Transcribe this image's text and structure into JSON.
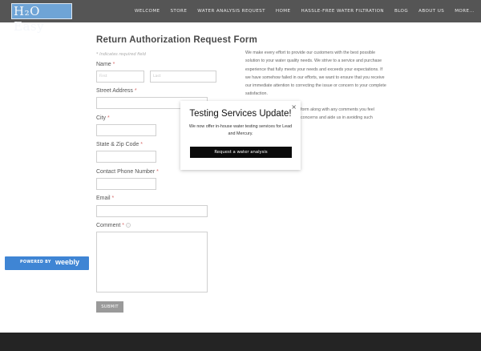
{
  "header": {
    "logo_text": "H₂O Easy",
    "nav": [
      "WELCOME",
      "STORE",
      "WATER ANALYSIS REQUEST",
      "HOME",
      "HASSLE-FREE WATER FILTRATION",
      "BLOG",
      "ABOUT US",
      "MORE..."
    ]
  },
  "form": {
    "title": "Return Authorization Request Form",
    "required_note": "* Indicates required field",
    "name_label": "Name",
    "first_placeholder": "First",
    "last_placeholder": "Last",
    "street_label": "Street Address",
    "city_label": "City",
    "state_label": "State & Zip Code",
    "phone_label": "Contact Phone Number",
    "email_label": "Email",
    "comment_label": "Comment",
    "required_star": "*",
    "help_glyph": "i",
    "submit_label": "SUBMIT"
  },
  "intro": {
    "paragraph1": "We make every effort to provide our customers with the best possible solution to your water quality needs. We strive to a service and purchase experience that fully meets your needs and exceeds your expectations. If we have somehow failed in our efforts, we want to ensure that you receive our immediate attention to correcting the issue or concern to your complete satisfaction.",
    "paragraph2": "form along with any comments you feel\nconcerns and aide us in avoiding such"
  },
  "popup": {
    "close": "×",
    "title": "Testing Services Update!",
    "body": "We now offer in-house water testing services for Lead and Mercury.",
    "button": "Request a water analysis"
  },
  "badge": {
    "powered_by": "POWERED BY",
    "brand": "weebly"
  }
}
